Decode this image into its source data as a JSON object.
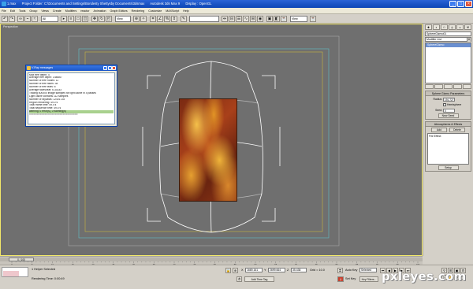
{
  "window": {
    "file": "1.max",
    "project_folder": "Project Folder: C:\\Documents and Settings\\Bondesty Shettysby Documents\\3dsmax",
    "app": "Autodesk 3ds Max 9",
    "display": "Display : OpenGL"
  },
  "menu": [
    "File",
    "Edit",
    "Tools",
    "Group",
    "Views",
    "Create",
    "Modifiers",
    "reactor",
    "Animation",
    "Graph Editors",
    "Rendering",
    "Customize",
    "MAXScript",
    "Help"
  ],
  "toolbar": {
    "selection_filter": "All",
    "ref_coord": "View",
    "named_sel": "",
    "render_mode": "View"
  },
  "viewport": {
    "label": "Perspective"
  },
  "message_window": {
    "title": "V-Ray messages",
    "lines": [
      "Max tree depth: 4",
      "Average tree depth: 3.66667",
      "Number of tree nodes: 11",
      "Number of tree faces: 38",
      "Number of tree leafs: 6",
      "Average faces/leaf: 6.33333",
      "Tracing 600000 image samples for light cache in 4 passes",
      "Light cache contains 112 samples",
      "Number of raycasts: 12401728",
      "Region rendering: 49.0 s",
      "Total frame time: 49.4 s",
      "Total sequence time: 49.4 s",
      "warning: 0 error(s), 0 warning(s)",
      "================================"
    ],
    "highlight_index": 12
  },
  "command_panel": {
    "object_name": "SphereGizmo01",
    "modifier_list": "Modifier List",
    "stack_item": "SphereGizmo",
    "rollout1_title": "Sphere Gizmo Parameters",
    "radius_label": "Radius:",
    "radius_value": "191.727",
    "hemisphere_label": "Hemisphere",
    "seed_label": "Seed:",
    "seed_value": "0",
    "new_seed": "New Seed",
    "rollout2_title": "Atmospheres & Effects",
    "add": "Add",
    "delete": "Delete",
    "effect": "Fire Effect",
    "setup": "Setup"
  },
  "timeline": {
    "frame": "0 / 100",
    "ticks": [
      "0",
      "5",
      "10",
      "15",
      "20",
      "25",
      "30",
      "35",
      "40",
      "45",
      "50",
      "55",
      "60",
      "65",
      "70",
      "75",
      "80",
      "85",
      "90",
      "95",
      "100"
    ]
  },
  "status": {
    "selection": "1 Helper Selected",
    "prompt": "Rendering Time: 0:00:49",
    "x": "1669.161",
    "y": "2699.664",
    "z": "35.438",
    "grid": "Grid = 10.0",
    "add_time_tag": "Add Time Tag",
    "auto_key": "Auto Key",
    "set_key": "Set Key",
    "selected": "Selected",
    "key_filters": "Key Filters..."
  },
  "watermark": "pxleyes.com"
}
